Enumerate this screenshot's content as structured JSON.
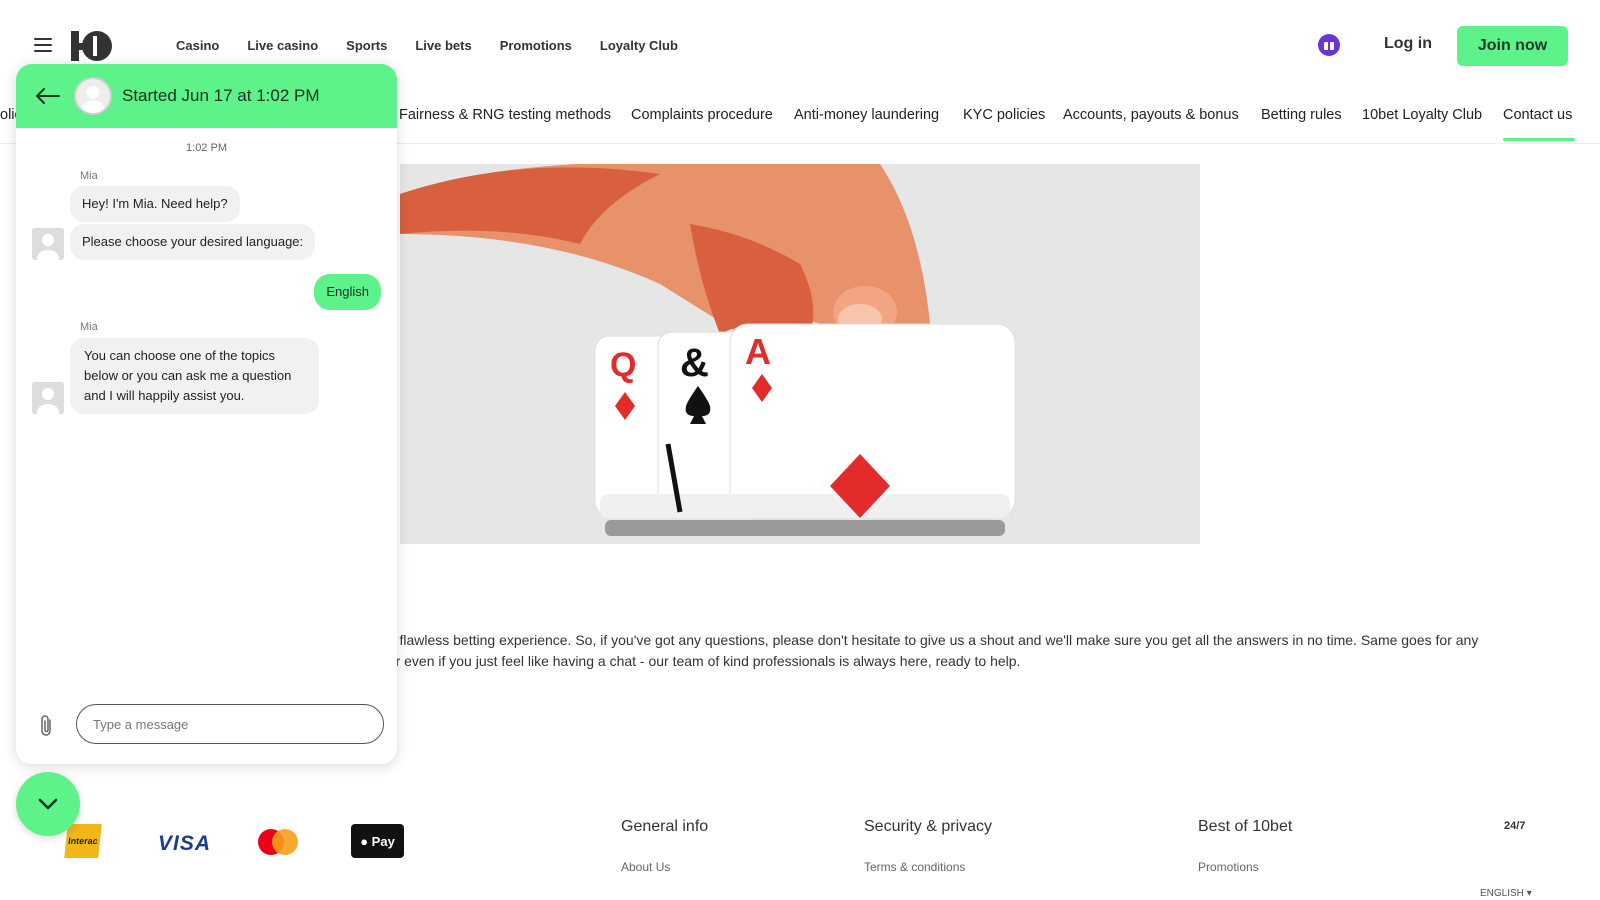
{
  "header": {
    "nav": [
      "Casino",
      "Live casino",
      "Sports",
      "Live bets",
      "Promotions",
      "Loyalty Club"
    ],
    "login_label": "Log in",
    "join_label": "Join now",
    "gift_icon": "gift-icon",
    "accent_color": "#5ef28a"
  },
  "subtabs": {
    "partial": "olic",
    "items": [
      "Fairness & RNG testing methods",
      "Complaints procedure",
      "Anti-money laundering",
      "KYC policies",
      "Accounts, payouts & bonus",
      "Betting rules",
      "10bet Loyalty Club",
      "Contact us"
    ],
    "active": "Contact us"
  },
  "content": {
    "line1": "nd flawless betting experience. So, if you've got any questions, please don't hesitate to give us a shout and we'll make sure you get all the answers in no time. Same goes for any",
    "line2": ", or even if you just feel like having a chat - our team of kind professionals is always here, ready to help."
  },
  "footer": {
    "payments": [
      "Interac",
      "VISA",
      "MasterCard",
      "Pay"
    ],
    "col1": {
      "title": "General info",
      "link": "About Us"
    },
    "col2": {
      "title": "Security & privacy",
      "link": "Terms & conditions"
    },
    "col3": {
      "title": "Best of 10bet",
      "link": "Promotions"
    },
    "badge": "24/7",
    "language": "ENGLISH"
  },
  "chat": {
    "title": "Started Jun 17 at 1:02 PM",
    "timestamp": "1:02 PM",
    "agent_name": "Mia",
    "msg1": "Hey! I'm Mia. Need help?",
    "msg2": "Please choose your desired language:",
    "user_reply": "English",
    "msg3_line1": "You can choose one of the topics",
    "msg3_line2": "below or you can ask me a question",
    "msg3_line3": "and I will happily assist you.",
    "input_placeholder": "Type a message"
  }
}
